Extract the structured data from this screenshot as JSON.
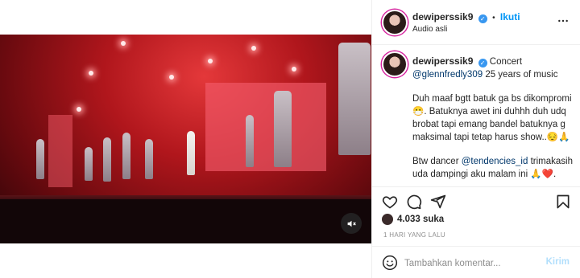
{
  "post": {
    "username": "dewiperssik9",
    "follow_label": "Ikuti",
    "separator": "•",
    "audio_label": "Audio asli",
    "caption_location": "Concert",
    "caption_mention": "@glennfredly309",
    "caption_mention_suffix": " 25 years of music",
    "caption_body": "Duh maaf bgtt batuk ga bs dikompromi 😷. Batuknya awet ini duhhh duh udq brobat tapi emang bandel batuknya g maksimal tapi tetap harus show..😔🙏",
    "caption_thanks_prefix": "Btw dancer ",
    "caption_thanks_mention": "@tendencies_id",
    "caption_thanks_suffix": " trimakasih uda dampingi aku malam ini 🙏❤️.",
    "likes": "4.033 suka",
    "timestamp": "1 HARI YANG LALU",
    "comment_placeholder": "Tambahkan komentar...",
    "post_button": "Kirim"
  },
  "icons": {
    "more": "more-options-icon",
    "like": "heart-icon",
    "comment": "comment-icon",
    "share": "share-icon",
    "save": "bookmark-icon",
    "emoji": "emoji-icon",
    "mute": "mute-icon"
  },
  "colors": {
    "accent": "#0095f6",
    "verified": "#3897f0",
    "stage_red": "#b0161c"
  }
}
